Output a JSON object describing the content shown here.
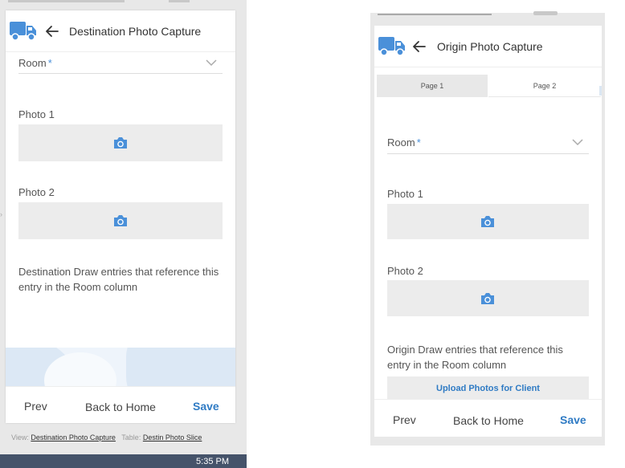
{
  "left": {
    "title": "Destination Photo Capture",
    "room_label": "Room",
    "required_mark": "*",
    "photo1_label": "Photo 1",
    "photo2_label": "Photo 2",
    "description": "Destination Draw entries that reference this entry in the Room column",
    "footer": {
      "prev": "Prev",
      "home": "Back to Home",
      "save": "Save"
    },
    "breadcrumb": {
      "view_label": "View:",
      "view_value": "Destination Photo Capture",
      "table_label": "Table:",
      "table_value": "Destin Photo Slice"
    },
    "taskbar_time": "5:35 PM"
  },
  "right": {
    "title": "Origin Photo Capture",
    "tabs": [
      {
        "label": "Page 1",
        "active": false
      },
      {
        "label": "Page 2",
        "active": true
      }
    ],
    "room_label": "Room",
    "required_mark": "*",
    "photo1_label": "Photo 1",
    "photo2_label": "Photo 2",
    "description": "Origin Draw entries that reference this entry in the Room column",
    "upload_button": "Upload Photos for Client",
    "footer": {
      "prev": "Prev",
      "home": "Back to Home",
      "save": "Save"
    }
  },
  "icons": {
    "brand": "truck-icon",
    "back": "arrow-left-icon",
    "camera": "camera-icon",
    "dropdown": "chevron-down-icon"
  },
  "colors": {
    "accent": "#2f7bc4",
    "icon_blue": "#4a90d9",
    "photo_box": "#ececec",
    "frame_gray": "#e8e8e8",
    "taskbar": "#45536a"
  }
}
